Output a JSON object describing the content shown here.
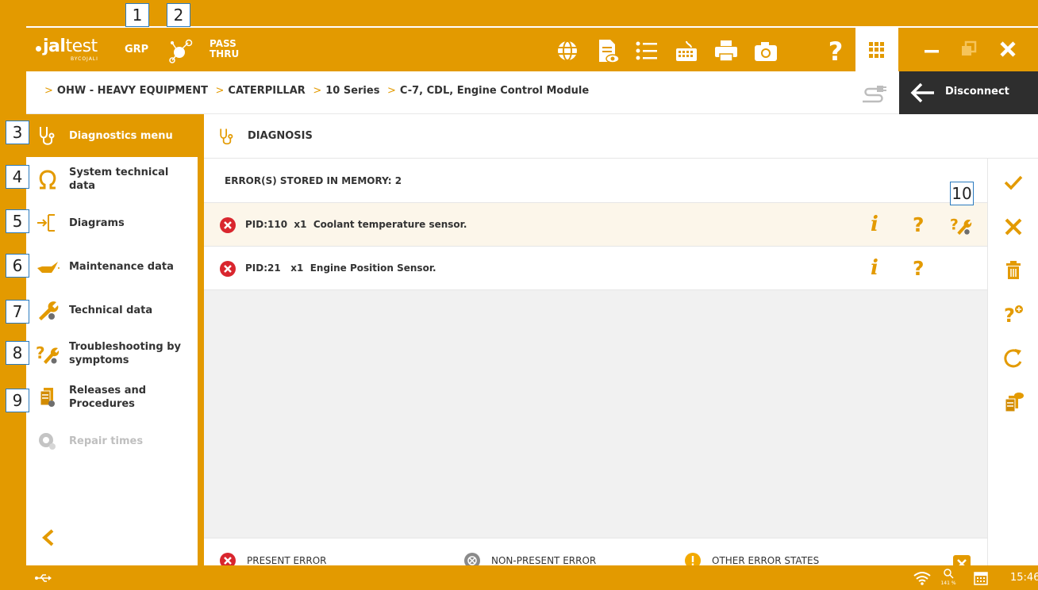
{
  "brand": {
    "logo_main": "jal",
    "logo_thin": "test",
    "logo_sub": "BYCOJALI",
    "mode": "GRP",
    "pass_line1": "PASS",
    "pass_line2": "THRU"
  },
  "toolbar_icons": [
    "globe-icon",
    "document-eye-icon",
    "list-icon",
    "keyboard-icon",
    "printer-icon",
    "camera-icon",
    "help-icon",
    "apps-grid-icon",
    "minimize-icon",
    "restore-icon",
    "close-icon"
  ],
  "breadcrumb": [
    "OHW - HEAVY EQUIPMENT",
    "CATERPILLAR",
    "10 Series",
    "C-7, CDL, Engine Control Module"
  ],
  "disconnect_label": "Disconnect",
  "sidebar": {
    "items": [
      {
        "label": "Diagnostics menu",
        "icon": "stethoscope-icon",
        "state": "active"
      },
      {
        "label": "System technical data",
        "icon": "omega-icon",
        "state": "normal"
      },
      {
        "label": "Diagrams",
        "icon": "diagram-icon",
        "state": "normal"
      },
      {
        "label": "Maintenance data",
        "icon": "oil-can-icon",
        "state": "normal"
      },
      {
        "label": "Technical data",
        "icon": "wrench-icon",
        "state": "normal"
      },
      {
        "label": "Troubleshooting by symptoms",
        "icon": "troubleshoot-icon",
        "state": "normal"
      },
      {
        "label": "Releases and Procedures",
        "icon": "releases-icon",
        "state": "normal"
      },
      {
        "label": "Repair times",
        "icon": "repair-times-icon",
        "state": "disabled"
      }
    ]
  },
  "main": {
    "header": "DIAGNOSIS",
    "errors_count_label": "ERROR(S) STORED IN MEMORY: 2",
    "errors": [
      {
        "text": "PID:110  x1  Coolant temperature sensor.",
        "info": "i",
        "help": "?"
      },
      {
        "text": "PID:21   x1  Engine Position Sensor.",
        "info": "i",
        "help": "?"
      }
    ],
    "legend": [
      "PRESENT ERROR",
      "NON-PRESENT ERROR",
      "OTHER ERROR STATES"
    ]
  },
  "status": {
    "zoom": "141 %",
    "time": "15:46"
  },
  "annotations": [
    "1",
    "2",
    "3",
    "4",
    "5",
    "6",
    "7",
    "8",
    "9",
    "10"
  ],
  "colors": {
    "accent": "#E39A00",
    "error": "#D9262E",
    "dark": "#2E2E2E",
    "grey_icon": "#6E6E6E"
  }
}
